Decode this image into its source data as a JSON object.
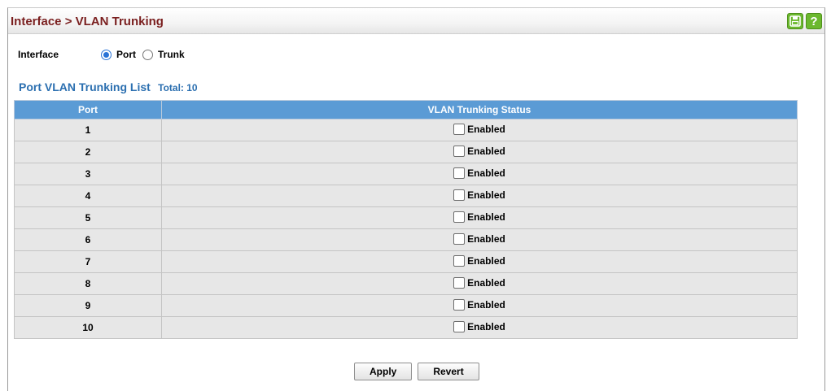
{
  "header": {
    "title": "Interface > VLAN Trunking",
    "icons": [
      "save-icon",
      "help-icon"
    ],
    "help_glyph": "?"
  },
  "interface": {
    "label": "Interface",
    "options": [
      {
        "label": "Port",
        "checked": true
      },
      {
        "label": "Trunk",
        "checked": false
      }
    ]
  },
  "list": {
    "title": "Port VLAN Trunking List",
    "total": "Total: 10",
    "columns": [
      "Port",
      "VLAN Trunking Status"
    ],
    "rows": [
      {
        "port": "1",
        "status": "Enabled",
        "checked": false
      },
      {
        "port": "2",
        "status": "Enabled",
        "checked": false
      },
      {
        "port": "3",
        "status": "Enabled",
        "checked": false
      },
      {
        "port": "4",
        "status": "Enabled",
        "checked": false
      },
      {
        "port": "5",
        "status": "Enabled",
        "checked": false
      },
      {
        "port": "6",
        "status": "Enabled",
        "checked": false
      },
      {
        "port": "7",
        "status": "Enabled",
        "checked": false
      },
      {
        "port": "8",
        "status": "Enabled",
        "checked": false
      },
      {
        "port": "9",
        "status": "Enabled",
        "checked": false
      },
      {
        "port": "10",
        "status": "Enabled",
        "checked": false
      }
    ]
  },
  "buttons": {
    "apply": "Apply",
    "revert": "Revert"
  },
  "colors": {
    "title": "#7a1f1f",
    "accent": "#2b6fb0",
    "header_bg": "#5b9bd5",
    "icon_green": "#6bb82e"
  }
}
